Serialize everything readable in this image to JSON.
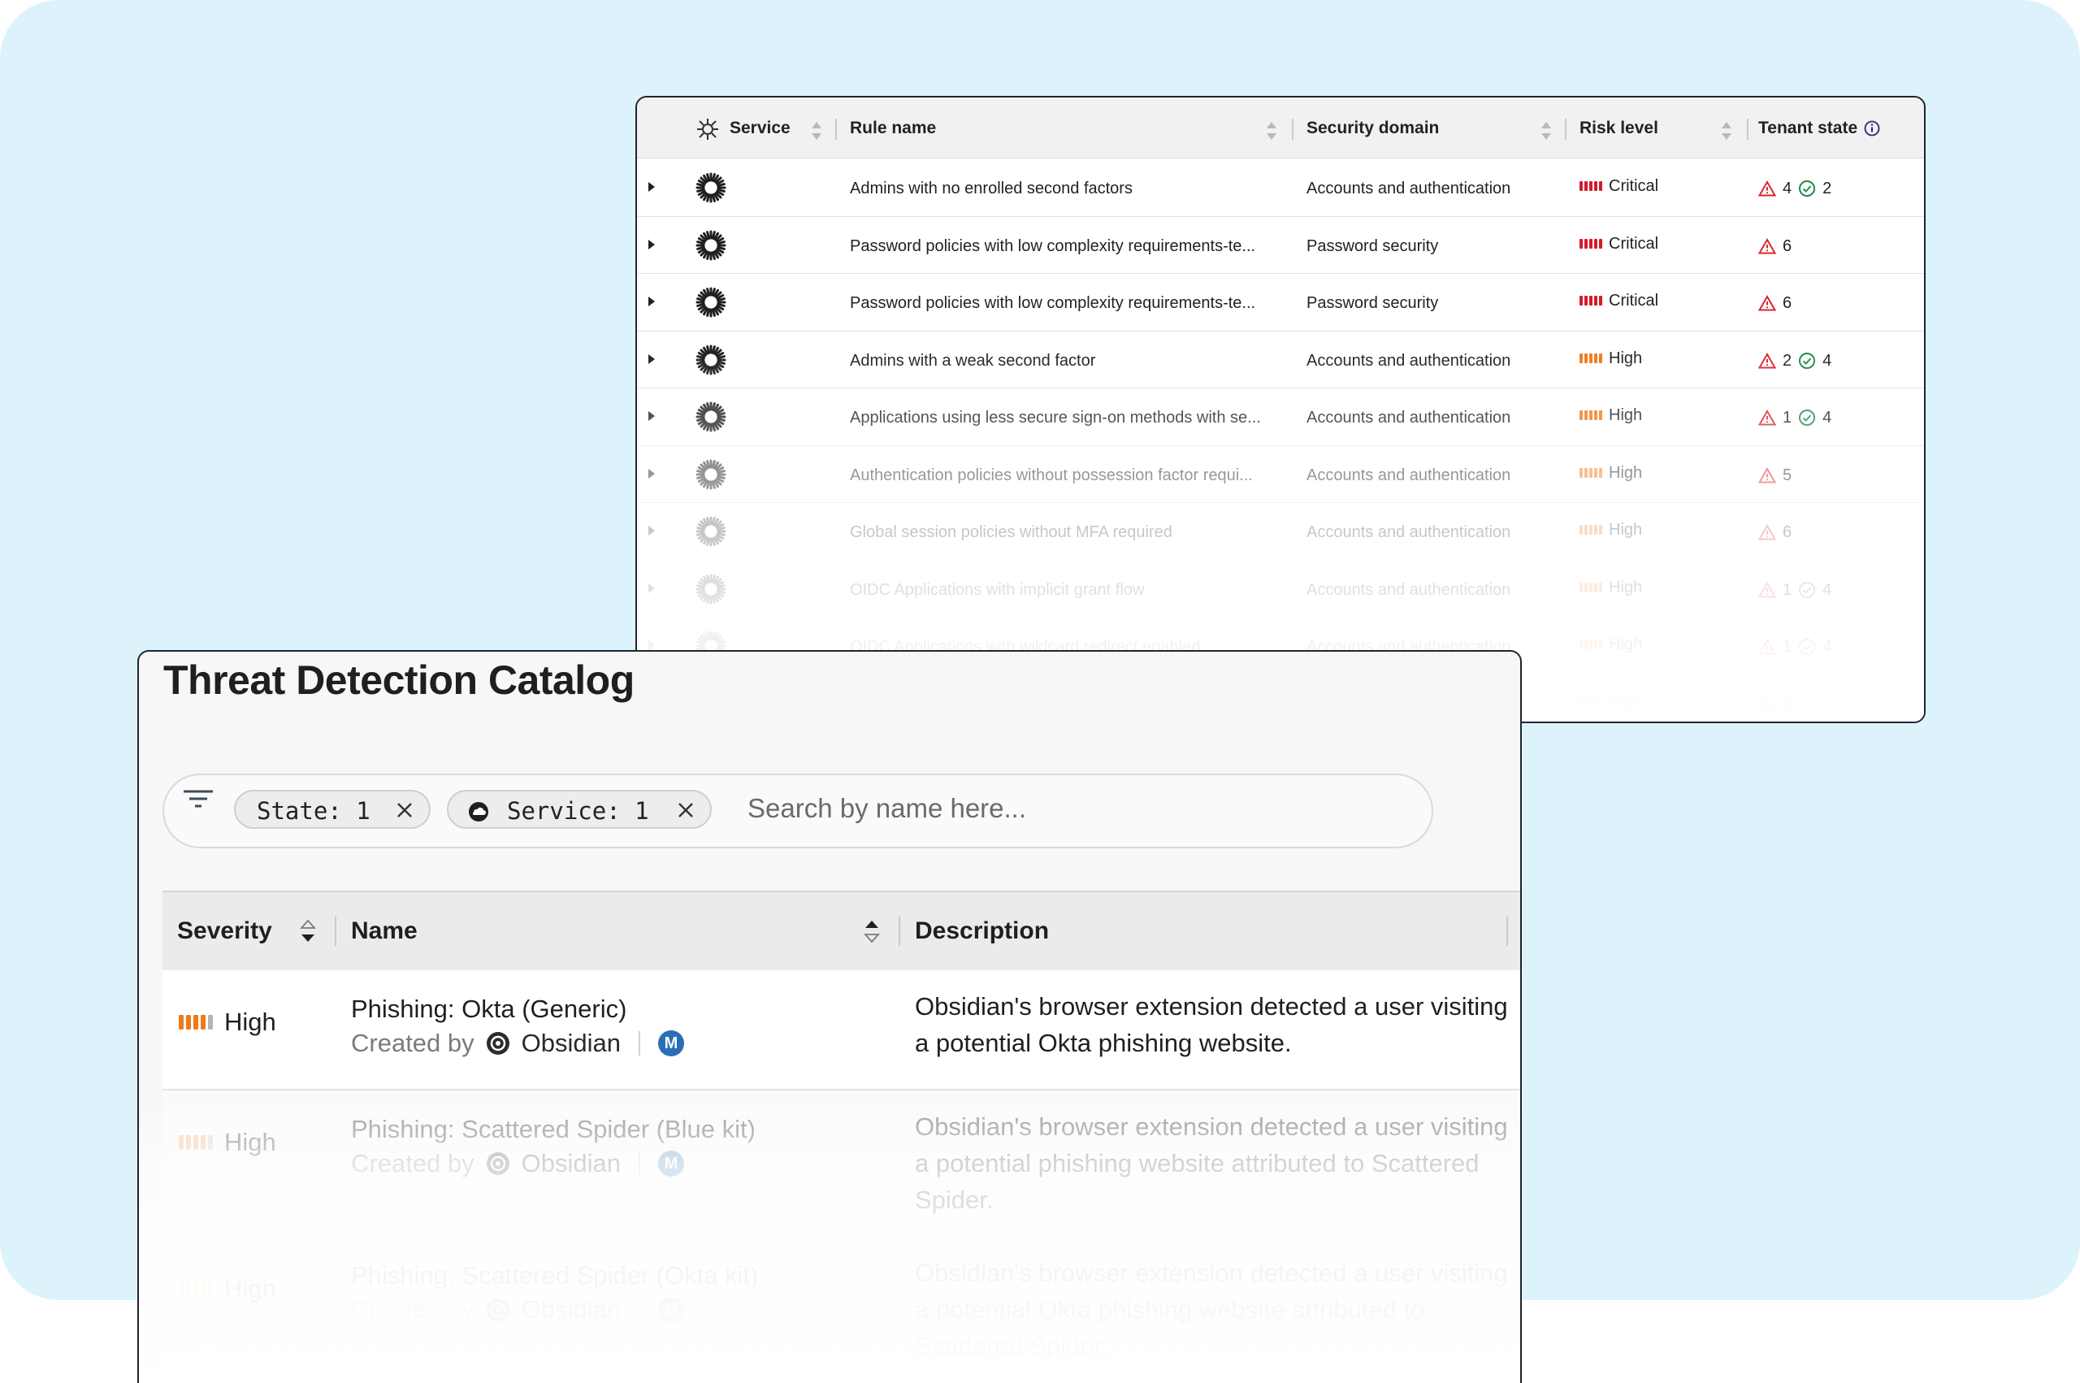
{
  "back_table": {
    "headers": {
      "service": "Service",
      "rule_name": "Rule name",
      "security_domain": "Security domain",
      "risk_level": "Risk level",
      "tenant_state": "Tenant state"
    },
    "rows": [
      {
        "rule": "Admins with no enrolled second factors",
        "domain": "Accounts and authentication",
        "risk": "Critical",
        "alerts": "4",
        "ok": "2"
      },
      {
        "rule": "Password policies with low complexity requirements-te...",
        "domain": "Password security",
        "risk": "Critical",
        "alerts": "6",
        "ok": ""
      },
      {
        "rule": "Password policies with low complexity requirements-te...",
        "domain": "Password security",
        "risk": "Critical",
        "alerts": "6",
        "ok": ""
      },
      {
        "rule": "Admins with a weak second factor",
        "domain": "Accounts and authentication",
        "risk": "High",
        "alerts": "2",
        "ok": "4"
      },
      {
        "rule": "Applications using less secure sign-on methods with se...",
        "domain": "Accounts and authentication",
        "risk": "High",
        "alerts": "1",
        "ok": "4"
      },
      {
        "rule": "Authentication policies without possession factor requi...",
        "domain": "Accounts and authentication",
        "risk": "High",
        "alerts": "5",
        "ok": ""
      },
      {
        "rule": "Global session policies without MFA required",
        "domain": "Accounts and authentication",
        "risk": "High",
        "alerts": "6",
        "ok": ""
      },
      {
        "rule": "OIDC Applications with implicit grant flow",
        "domain": "Accounts and authentication",
        "risk": "High",
        "alerts": "1",
        "ok": "4"
      },
      {
        "rule": "OIDC Applications with wildcard redirect enabled",
        "domain": "Accounts and authentication",
        "risk": "High",
        "alerts": "1",
        "ok": "4"
      },
      {
        "rule": "",
        "domain": "",
        "risk": "High",
        "alerts": "6",
        "ok": ""
      }
    ]
  },
  "catalog": {
    "title": "Threat Detection Catalog",
    "filters": {
      "state_chip": "State: 1",
      "service_chip": "Service: 1",
      "search_placeholder": "Search by name here..."
    },
    "headers": {
      "severity": "Severity",
      "name": "Name",
      "description": "Description"
    },
    "rows": [
      {
        "severity": "High",
        "name": "Phishing: Okta (Generic)",
        "created_by": "Created by",
        "org": "Obsidian",
        "badge": "M",
        "description": "Obsidian's browser extension detected a user visiting a potential Okta phishing website."
      },
      {
        "severity": "High",
        "name": "Phishing: Scattered Spider (Blue kit)",
        "created_by": "Created by",
        "org": "Obsidian",
        "badge": "M",
        "description": "Obsidian's browser extension detected a user visiting a potential phishing website attributed to Scattered Spider."
      },
      {
        "severity": "High",
        "name": "Phishing: Scattered Spider (Okta kit)",
        "created_by": "Created by",
        "org": "Obsidian",
        "badge": "M",
        "description": "Obsidian's browser extension detected a user visiting a potential Okta phishing website attributed to Scattered Spider."
      }
    ]
  },
  "colors": {
    "critical": "#d21d2a",
    "high": "#ee7a1a",
    "alert": "#d9262f",
    "ok": "#1f8a4c",
    "background": "#ddf3fb",
    "badge": "#2a6fb5"
  },
  "icons": [
    "okta-sunburst-icon",
    "sort-icon",
    "info-icon",
    "warning-triangle-icon",
    "check-circle-icon",
    "filter-icon",
    "close-icon",
    "cloud-icon",
    "obsidian-logo-icon"
  ]
}
